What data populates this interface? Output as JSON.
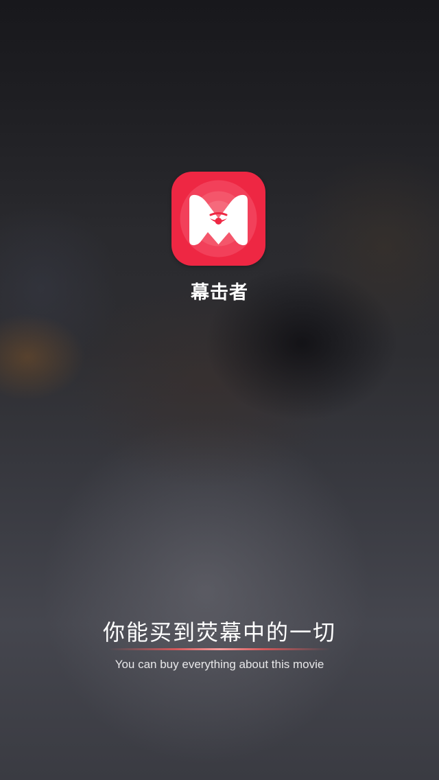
{
  "app": {
    "name": "幕击者",
    "icon": "m-eye-logo-icon",
    "brand_color": "#ee2743"
  },
  "splash": {
    "slogan": "你能买到荧幕中的一切",
    "tagline": "You can buy everything about this movie"
  }
}
